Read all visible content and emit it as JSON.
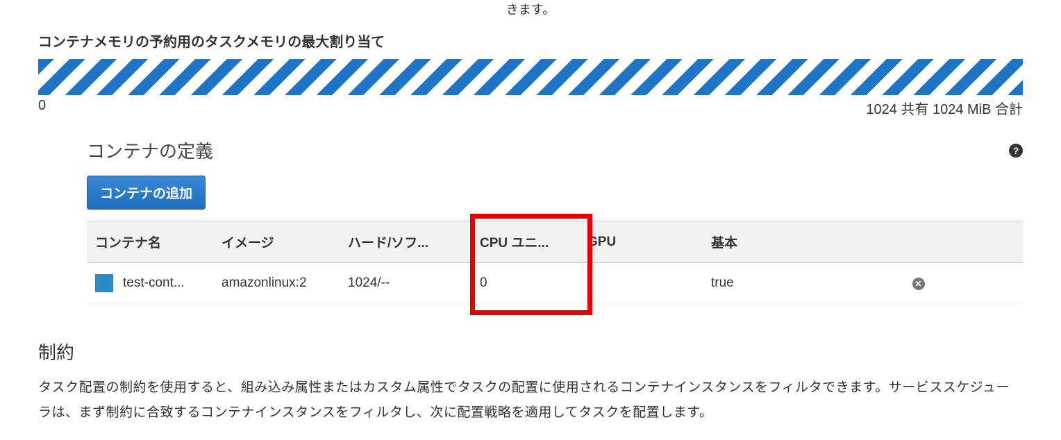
{
  "top_fragment": "きます。",
  "memory_section": {
    "heading": "コンテナメモリの予約用のタスクメモリの最大割り当て",
    "min_label": "0",
    "max_label": "1024 共有 1024 MiB 合計"
  },
  "container_def": {
    "heading": "コンテナの定義",
    "add_button": "コンテナの追加",
    "columns": {
      "name": "コンテナ名",
      "image": "イメージ",
      "memory": "ハード/ソフ...",
      "cpu": "CPU ユニ...",
      "gpu": "GPU",
      "essential": "基本"
    },
    "rows": [
      {
        "name": "test-cont...",
        "image": "amazonlinux:2",
        "memory": "1024/--",
        "cpu": "0",
        "gpu": "",
        "essential": "true"
      }
    ]
  },
  "constraints": {
    "heading": "制約",
    "description": "タスク配置の制約を使用すると、組み込み属性またはカスタム属性でタスクの配置に使用されるコンテナインスタンスをフィルタできます。サービススケジューラは、まず制約に合致するコンテナインスタンスをフィルタし、次に配置戦略を適用してタスクを配置します。"
  }
}
